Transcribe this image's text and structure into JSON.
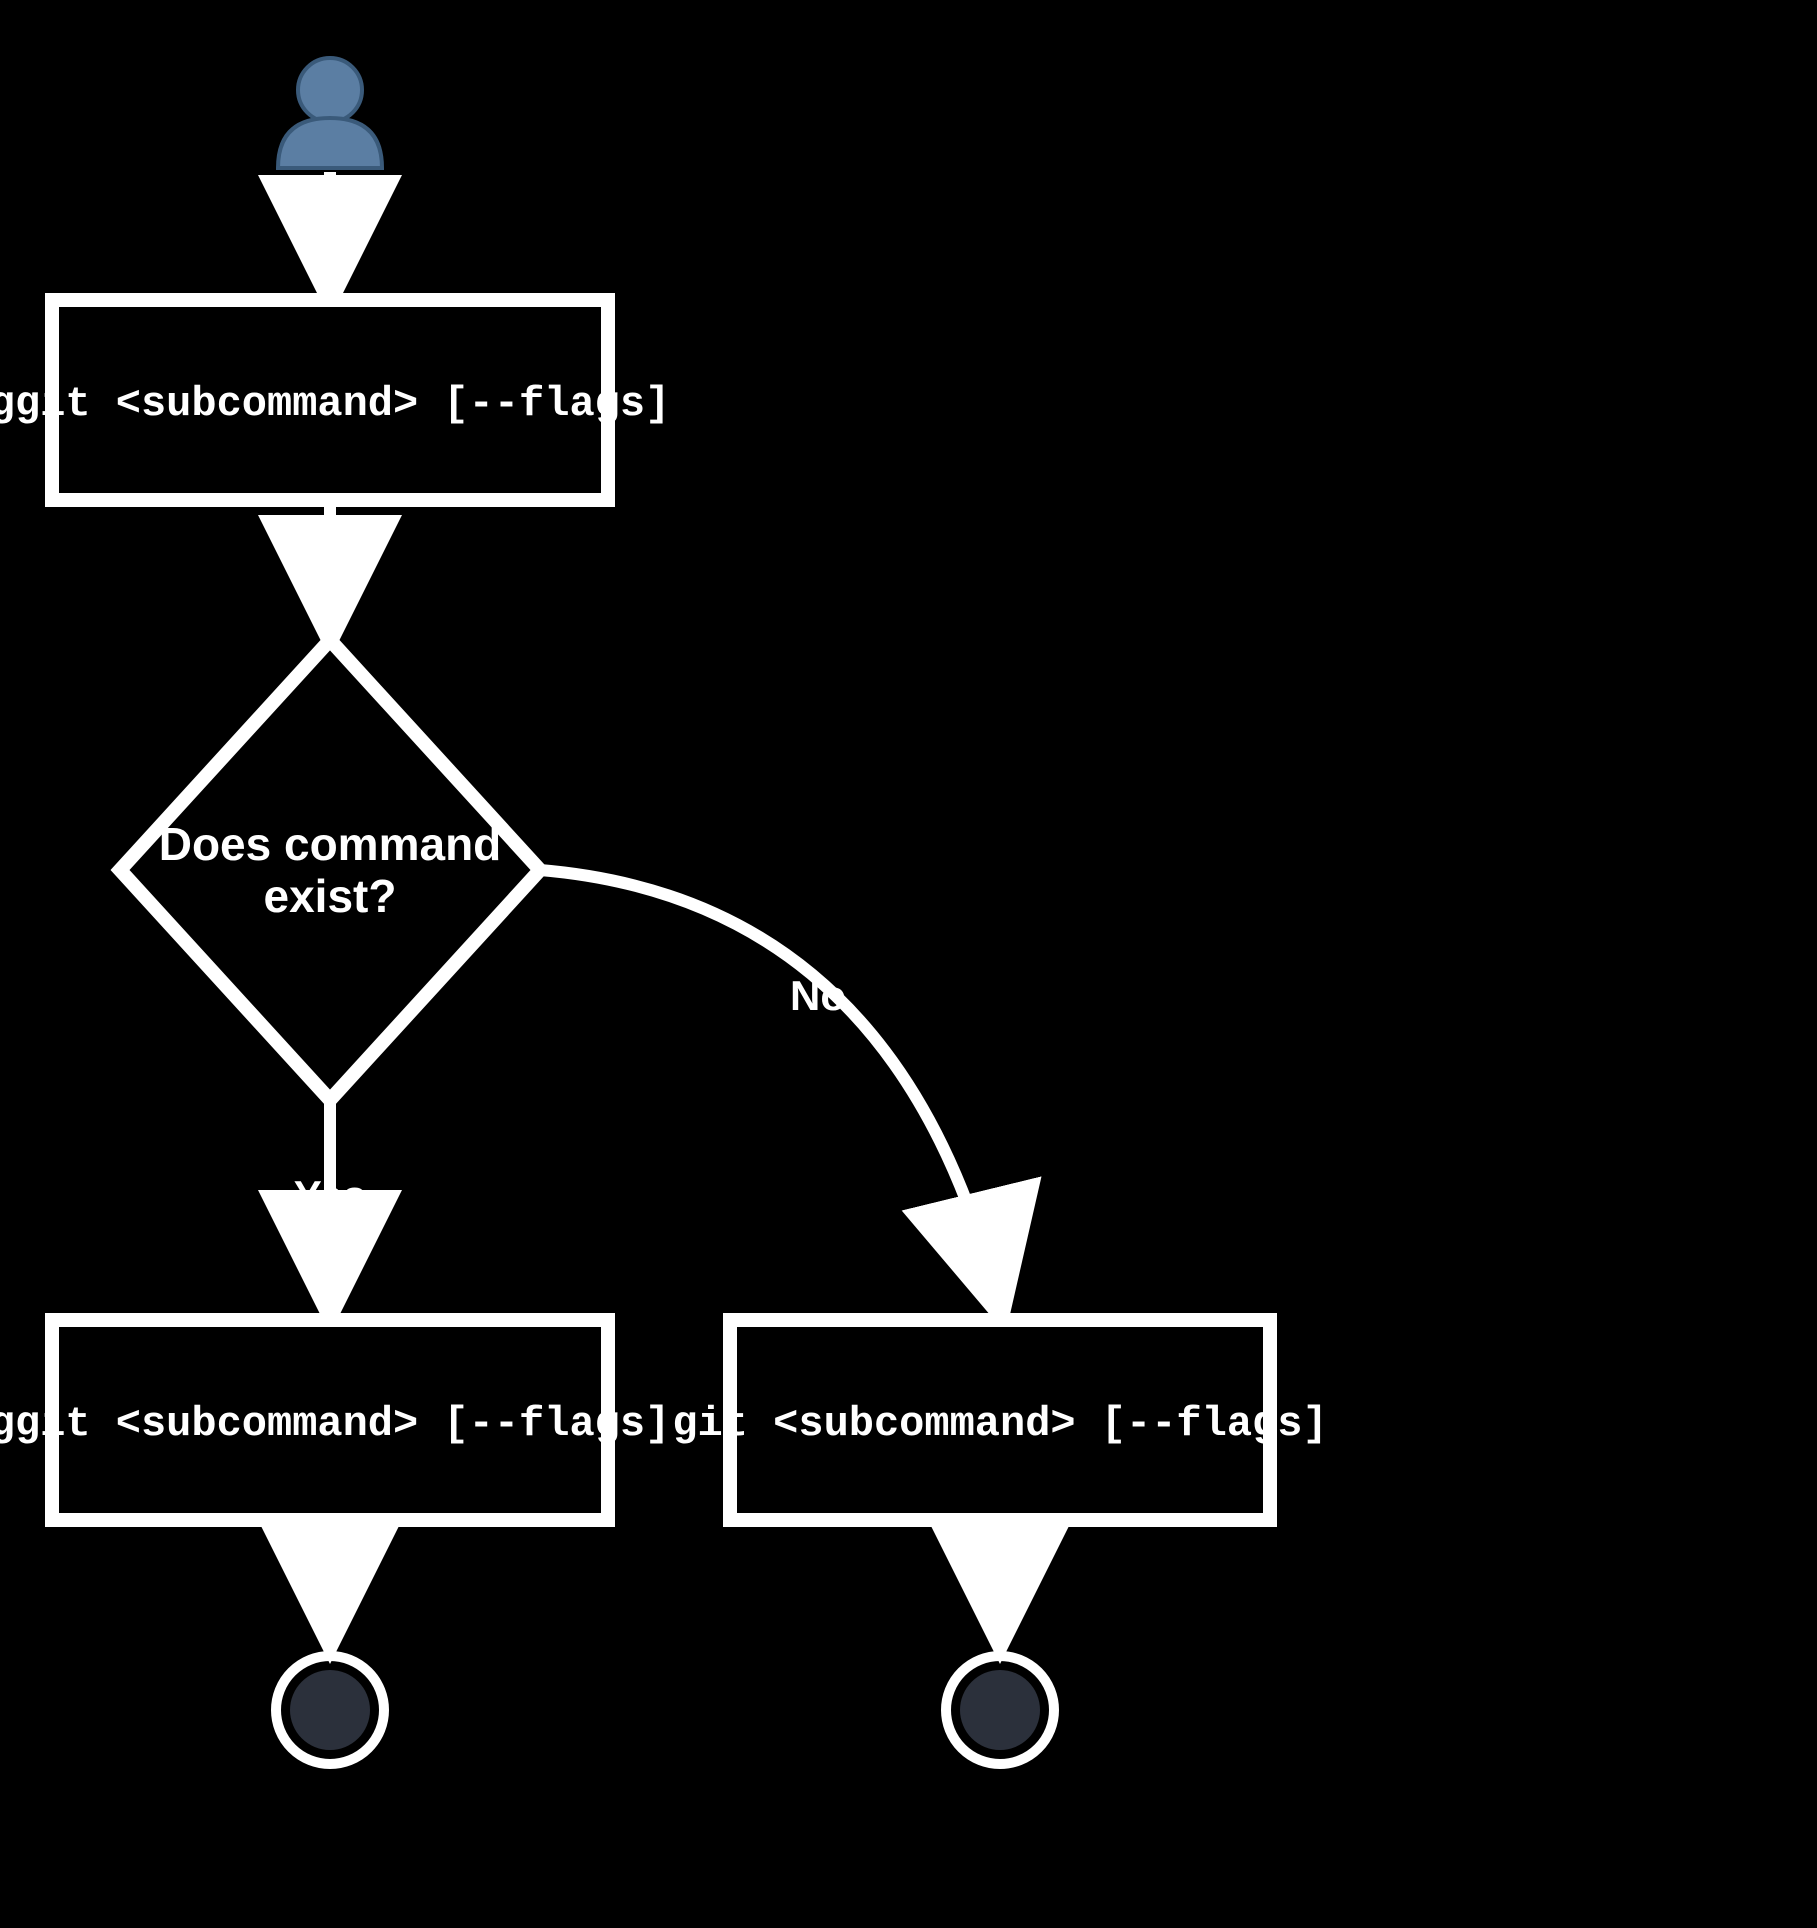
{
  "nodes": {
    "start_actor": "user",
    "input_command": "ggit <subcommand> [--flags]",
    "decision_line1": "Does command",
    "decision_line2": "exist?",
    "branch_yes_command": "ggit <subcommand> [--flags]",
    "branch_no_command": "git <subcommand> [--flags]"
  },
  "edges": {
    "yes_label": "Yes",
    "no_label": "No"
  },
  "colors": {
    "background": "#000000",
    "stroke": "#ffffff",
    "text": "#ffffff",
    "actor_fill": "#5b7ea3",
    "end_fill": "#2b303b"
  }
}
